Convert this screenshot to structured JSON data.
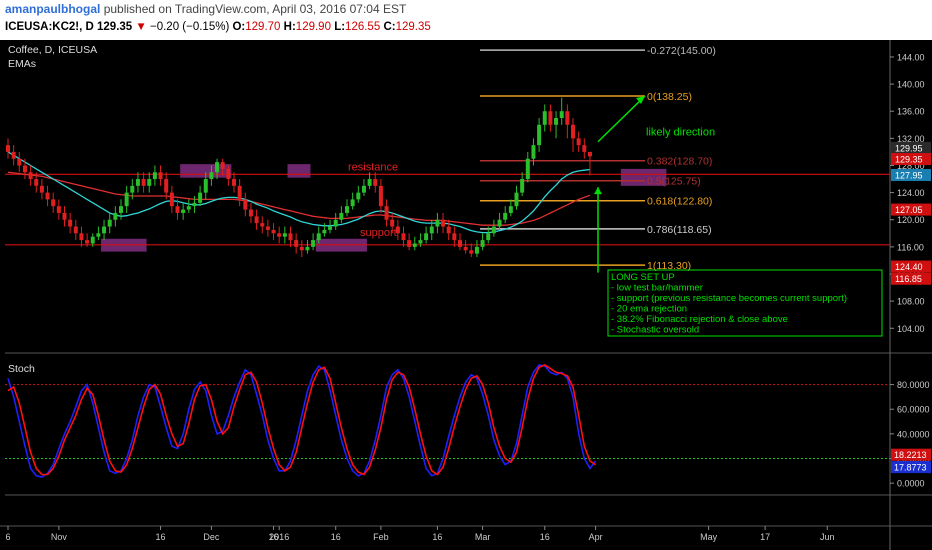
{
  "header": {
    "author": "amanpaulbhogal",
    "published_text": "published on TradingView.com, April 03, 2016 07:04 EST",
    "symbol": "ICEUSA:KC2!, D",
    "last": "129.35",
    "change": "−0.20 (−0.15%)",
    "o_label": "O:",
    "o": "129.70",
    "h_label": "H:",
    "h": "129.90",
    "l_label": "L:",
    "l": "126.55",
    "c_label": "C:",
    "c": "129.35"
  },
  "colors": {
    "up": "#2bbf2b",
    "down": "#e02020",
    "ema_fast": "#2fd6d6",
    "ema_slow": "#e03030",
    "fib_gold": "#e8a020",
    "fib_red": "#b03030",
    "fib_white": "#cccccc",
    "annotation_green": "#00e000",
    "stoch_k": "#2020ff",
    "stoch_d": "#ff1010",
    "zone": "#8a2f8a",
    "level_line": "#d01010"
  },
  "chart_data": [
    {
      "type": "candlestick",
      "title": "Coffee, D, ICEUSA",
      "indicator_label": "EMAs",
      "y_ticks": [
        "144.00",
        "140.00",
        "136.00",
        "132.00",
        "128.00",
        "124.00",
        "120.00",
        "116.00",
        "112.00",
        "108.00",
        "104.00"
      ],
      "x_ticks": [
        "6",
        "Nov",
        "16",
        "Dec",
        "16",
        "2016",
        "16",
        "Feb",
        "16",
        "Mar",
        "16",
        "Apr",
        "May",
        "17",
        "Jun"
      ],
      "ylim": [
        100.5,
        146.5
      ],
      "candles": [
        [
          131,
          130,
          132,
          129
        ],
        [
          130,
          129,
          131,
          128
        ],
        [
          129,
          128,
          130,
          127
        ],
        [
          128,
          127,
          129,
          126
        ],
        [
          127,
          126,
          128,
          125
        ],
        [
          126,
          125,
          127,
          124
        ],
        [
          125,
          124,
          126,
          123
        ],
        [
          124,
          123,
          125,
          122
        ],
        [
          123,
          122,
          124,
          121
        ],
        [
          122,
          121,
          123,
          120
        ],
        [
          121,
          120,
          122,
          119
        ],
        [
          120,
          119,
          121,
          118
        ],
        [
          119,
          118,
          120,
          117
        ],
        [
          118,
          117,
          119,
          116
        ],
        [
          117,
          116.5,
          118,
          116
        ],
        [
          116.5,
          117.5,
          118,
          116
        ],
        [
          117.5,
          118,
          119,
          117
        ],
        [
          118,
          119,
          120,
          117
        ],
        [
          119,
          120,
          121,
          118
        ],
        [
          120,
          121,
          122,
          119
        ],
        [
          121,
          122,
          123,
          120
        ],
        [
          122,
          124,
          125,
          121
        ],
        [
          124,
          125,
          126,
          123
        ],
        [
          125,
          126,
          127,
          124
        ],
        [
          126,
          125,
          127,
          124
        ],
        [
          125,
          126,
          127,
          124
        ],
        [
          126,
          127,
          128,
          125
        ],
        [
          127,
          126,
          128,
          125
        ],
        [
          126,
          124,
          127,
          123
        ],
        [
          124,
          122,
          125,
          121
        ],
        [
          122,
          121,
          123,
          120
        ],
        [
          121,
          121.5,
          122.5,
          120
        ],
        [
          121.5,
          122,
          123,
          121
        ],
        [
          122,
          122.5,
          123.5,
          121
        ],
        [
          122.5,
          124,
          125,
          122
        ],
        [
          124,
          126,
          127,
          123
        ],
        [
          126,
          127,
          128,
          125
        ],
        [
          127,
          128.5,
          129,
          126
        ],
        [
          128.5,
          127.5,
          129,
          126.5
        ],
        [
          127.5,
          126,
          128,
          125
        ],
        [
          126,
          125,
          127,
          124
        ],
        [
          125,
          123,
          126,
          122
        ],
        [
          123,
          121.5,
          124,
          120.5
        ],
        [
          121.5,
          120.5,
          122.5,
          119.5
        ],
        [
          120.5,
          119.5,
          121.5,
          118.5
        ],
        [
          119.5,
          119,
          120.5,
          118
        ],
        [
          119,
          118.5,
          120,
          117.5
        ],
        [
          118.5,
          118,
          119.5,
          117
        ],
        [
          118,
          117.5,
          119,
          116.5
        ],
        [
          117.5,
          118,
          119,
          116.5
        ],
        [
          118,
          117,
          119,
          116
        ],
        [
          117,
          116,
          118,
          115
        ],
        [
          116,
          115.5,
          117,
          114.5
        ],
        [
          115.5,
          116,
          117,
          115
        ],
        [
          116,
          117,
          118,
          115.5
        ],
        [
          117,
          118,
          119,
          116.5
        ],
        [
          118,
          118.5,
          119.5,
          117.5
        ],
        [
          118.5,
          119,
          120,
          118
        ],
        [
          119,
          120,
          121,
          118.5
        ],
        [
          120,
          121,
          122,
          119.5
        ],
        [
          121,
          122,
          123,
          120.5
        ],
        [
          122,
          123,
          124,
          121.5
        ],
        [
          123,
          124,
          125,
          122.5
        ],
        [
          124,
          125,
          126,
          123.5
        ],
        [
          125,
          126,
          127,
          124.5
        ],
        [
          126,
          125,
          127,
          124
        ],
        [
          125,
          122,
          126,
          121
        ],
        [
          122,
          120,
          123,
          119
        ],
        [
          120,
          119,
          121,
          118
        ],
        [
          119,
          118,
          120,
          117
        ],
        [
          118,
          117,
          119,
          116
        ],
        [
          117,
          116,
          118,
          115.5
        ],
        [
          116,
          116.5,
          117.5,
          115.5
        ],
        [
          116.5,
          117,
          118,
          116
        ],
        [
          117,
          118,
          119,
          116.5
        ],
        [
          118,
          119,
          120,
          117
        ],
        [
          119,
          120,
          121,
          118
        ],
        [
          120,
          119,
          121,
          118
        ],
        [
          119,
          118,
          120,
          117
        ],
        [
          118,
          117,
          119,
          116
        ],
        [
          117,
          116,
          118,
          115.5
        ],
        [
          116,
          115.5,
          117,
          115
        ],
        [
          115.5,
          115,
          116.5,
          114.5
        ],
        [
          115,
          116,
          117,
          114.5
        ],
        [
          116,
          117,
          118,
          115.5
        ],
        [
          117,
          118,
          119,
          116.5
        ],
        [
          118,
          119,
          120,
          117.5
        ],
        [
          119,
          120,
          121,
          118.5
        ],
        [
          120,
          121,
          122,
          119.5
        ],
        [
          121,
          122,
          123,
          120.5
        ],
        [
          122,
          124,
          125,
          121.5
        ],
        [
          124,
          126,
          127,
          123.5
        ],
        [
          126,
          129,
          130,
          125.5
        ],
        [
          129,
          131,
          132,
          128
        ],
        [
          131,
          134,
          135,
          130
        ],
        [
          134,
          136,
          137,
          133
        ],
        [
          136,
          134,
          137,
          133
        ],
        [
          134,
          135,
          136,
          132
        ],
        [
          135,
          136,
          138,
          134
        ],
        [
          136,
          134,
          137,
          132
        ],
        [
          134,
          132,
          135,
          130
        ],
        [
          132,
          131,
          133,
          130
        ],
        [
          131,
          130,
          132,
          129
        ],
        [
          130,
          129.35,
          130,
          126.55
        ]
      ],
      "ema_20": [
        130,
        129.5,
        129,
        128.5,
        128,
        127.5,
        127,
        126.5,
        126,
        125.5,
        125,
        124.5,
        124,
        123.5,
        123,
        122.5,
        122,
        121.5,
        121,
        120.7,
        120.5,
        120.6,
        120.8,
        121,
        121.3,
        121.6,
        122,
        122.4,
        122.7,
        122.8,
        122.7,
        122.5,
        122.3,
        122.2,
        122.2,
        122.4,
        122.7,
        123,
        123.2,
        123.3,
        123.3,
        123.2,
        123,
        122.7,
        122.3,
        122,
        121.7,
        121.3,
        121,
        120.7,
        120.4,
        120,
        119.7,
        119.5,
        119.3,
        119.2,
        119.1,
        119.1,
        119.2,
        119.3,
        119.5,
        119.8,
        120.1,
        120.5,
        120.9,
        121.2,
        121.3,
        121.2,
        121,
        120.7,
        120.4,
        120.1,
        119.8,
        119.6,
        119.5,
        119.5,
        119.5,
        119.5,
        119.4,
        119.2,
        119,
        118.7,
        118.4,
        118.2,
        118.1,
        118.1,
        118.2,
        118.4,
        118.6,
        118.9,
        119.3,
        119.8,
        120.5,
        121.3,
        122.3,
        123.4,
        124.3,
        125.1,
        126,
        126.6,
        127,
        127.2,
        127.3,
        127.4
      ],
      "ema_50": [
        127,
        126.9,
        126.8,
        126.7,
        126.6,
        126.5,
        126.4,
        126.2,
        126,
        125.8,
        125.6,
        125.4,
        125.2,
        125,
        124.8,
        124.6,
        124.4,
        124.2,
        124,
        123.8,
        123.7,
        123.6,
        123.5,
        123.5,
        123.5,
        123.5,
        123.5,
        123.5,
        123.5,
        123.4,
        123.3,
        123.2,
        123.1,
        123,
        123,
        123,
        123,
        123,
        123,
        123,
        123,
        122.9,
        122.8,
        122.7,
        122.5,
        122.3,
        122.1,
        121.9,
        121.7,
        121.5,
        121.3,
        121.1,
        120.9,
        120.7,
        120.5,
        120.4,
        120.3,
        120.2,
        120.2,
        120.2,
        120.2,
        120.3,
        120.4,
        120.5,
        120.6,
        120.7,
        120.7,
        120.6,
        120.5,
        120.4,
        120.3,
        120.2,
        120.1,
        120,
        119.9,
        119.9,
        119.9,
        119.9,
        119.8,
        119.7,
        119.6,
        119.5,
        119.4,
        119.3,
        119.2,
        119.2,
        119.2,
        119.2,
        119.2,
        119.3,
        119.4,
        119.5,
        119.7,
        119.9,
        120.2,
        120.6,
        121,
        121.4,
        121.8,
        122.2,
        122.6,
        123,
        123.3,
        123.6
      ],
      "horizontal_levels": {
        "resistance": 126.7,
        "support": 116.3
      },
      "zones": [
        {
          "from": 17,
          "to": 24,
          "lo": 115.3,
          "hi": 117.2
        },
        {
          "from": 31,
          "to": 39,
          "lo": 126.2,
          "hi": 128.2
        },
        {
          "from": 50,
          "to": 53,
          "lo": 126.2,
          "hi": 128.2
        },
        {
          "from": 55,
          "to": 63,
          "lo": 115.3,
          "hi": 117.2
        },
        {
          "from": 109,
          "to": 116,
          "lo": 125,
          "hi": 127.5
        }
      ],
      "fib_levels": [
        {
          "label": "-0.272(145.00)",
          "value": 145.0,
          "color": "#bbbbbb"
        },
        {
          "label": "0(138.25)",
          "value": 138.25,
          "color": "#e8a020"
        },
        {
          "label": "0.382(128.70)",
          "value": 128.7,
          "color": "#b03030"
        },
        {
          "label": "0.5(125.75)",
          "value": 125.75,
          "color": "#b03030"
        },
        {
          "label": "0.618(122.80)",
          "value": 122.8,
          "color": "#e8a020"
        },
        {
          "label": "0.786(118.65)",
          "value": 118.65,
          "color": "#cccccc"
        },
        {
          "label": "1(113.30)",
          "value": 113.3,
          "color": "#e8a020"
        }
      ],
      "annotations": {
        "resistance": "resistance",
        "support": "support",
        "likely_direction": "likely direction",
        "setup_lines": [
          "LONG SET UP",
          "- low test bar/hammer",
          "- support (previous resistance becomes current support)",
          "- 20 ema rejection",
          "- 38.2% Fibonacci rejection & close above",
          "- Stochastic oversold"
        ]
      },
      "price_badges": [
        {
          "text": "129.95",
          "value": 130.6,
          "bg": "#2b2b2b",
          "fg": "#ffffff"
        },
        {
          "text": "129.35",
          "value": 128.95,
          "bg": "#d01010",
          "fg": "#ffffff"
        },
        {
          "text": "127.95",
          "value": 126.6,
          "bg": "#1a7fb0",
          "fg": "#ffffff"
        },
        {
          "text": "127.05",
          "value": 121.5,
          "bg": "#d01010",
          "fg": "#ffffff"
        },
        {
          "text": "124.40",
          "value": 113.1,
          "bg": "#d01010",
          "fg": "#ffffff"
        },
        {
          "text": "116.85",
          "value": 111.3,
          "bg": "#d01010",
          "fg": "#ffffff"
        }
      ]
    },
    {
      "type": "line",
      "title": "Stoch",
      "y_ticks": [
        "80.0000",
        "60.0000",
        "40.0000",
        "20.0000",
        "0.0000"
      ],
      "ylim": [
        -8,
        104
      ],
      "levels": [
        80,
        20
      ],
      "series": [
        {
          "name": "%K",
          "color": "#2020ff",
          "values": [
            85,
            70,
            50,
            30,
            12,
            6,
            5,
            8,
            15,
            28,
            40,
            50,
            62,
            75,
            80,
            65,
            45,
            25,
            10,
            8,
            10,
            20,
            35,
            55,
            70,
            80,
            78,
            62,
            45,
            30,
            28,
            40,
            60,
            76,
            82,
            75,
            55,
            40,
            42,
            55,
            70,
            82,
            92,
            88,
            72,
            55,
            35,
            20,
            10,
            10,
            18,
            35,
            55,
            75,
            88,
            95,
            92,
            75,
            55,
            35,
            20,
            10,
            6,
            8,
            18,
            35,
            55,
            78,
            88,
            92,
            85,
            70,
            50,
            30,
            12,
            6,
            8,
            20,
            38,
            55,
            70,
            82,
            88,
            85,
            72,
            55,
            35,
            22,
            15,
            18,
            32,
            55,
            78,
            90,
            96,
            95,
            90,
            88,
            90,
            85,
            70,
            40,
            20,
            12,
            18
          ]
        },
        {
          "name": "%D",
          "color": "#ff1010",
          "values": [
            75,
            78,
            65,
            45,
            25,
            12,
            7,
            7,
            12,
            22,
            35,
            45,
            55,
            68,
            77,
            72,
            55,
            35,
            18,
            10,
            9,
            15,
            28,
            45,
            62,
            76,
            80,
            72,
            55,
            40,
            30,
            32,
            48,
            68,
            79,
            80,
            68,
            50,
            40,
            45,
            62,
            76,
            88,
            90,
            82,
            65,
            45,
            28,
            15,
            10,
            13,
            25,
            45,
            65,
            82,
            92,
            94,
            85,
            65,
            45,
            28,
            15,
            9,
            7,
            13,
            27,
            45,
            68,
            84,
            90,
            88,
            78,
            60,
            40,
            22,
            10,
            7,
            13,
            28,
            46,
            62,
            76,
            85,
            87,
            80,
            65,
            45,
            30,
            20,
            17,
            25,
            45,
            68,
            85,
            94,
            96,
            93,
            90,
            89,
            87,
            78,
            55,
            30,
            18,
            15
          ]
        }
      ],
      "value_badges": [
        {
          "text": "18.2213",
          "value": 18.2213,
          "bg": "#d01010",
          "fg": "#ffffff"
        },
        {
          "text": "17.8773",
          "value": 17.8773,
          "bg": "#1a2fd0",
          "fg": "#ffffff"
        }
      ]
    }
  ]
}
